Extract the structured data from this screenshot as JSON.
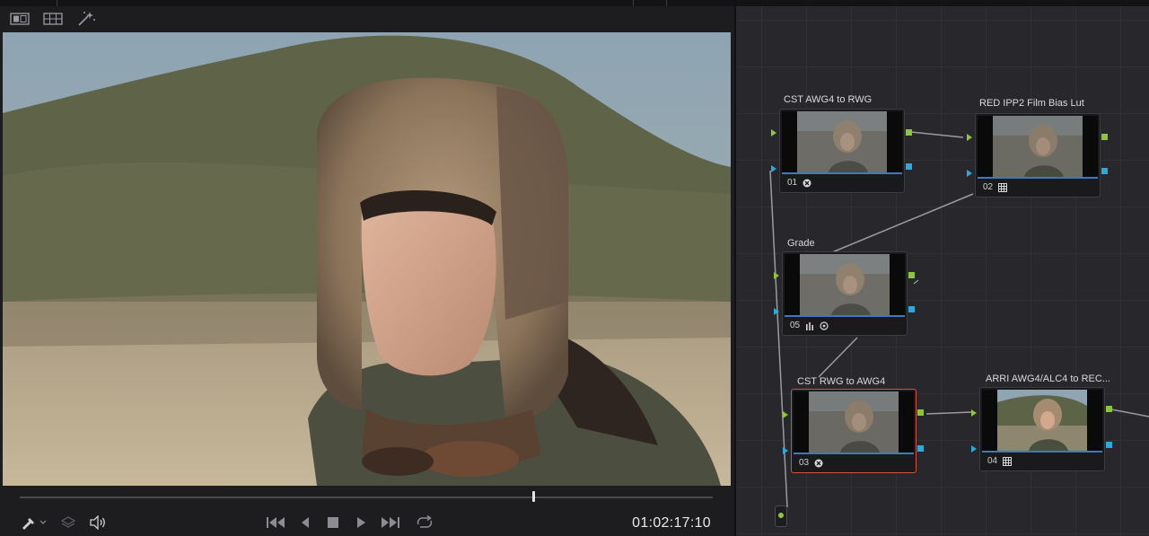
{
  "viewer": {
    "timecode": "01:02:17:10",
    "playhead_fraction": 0.74,
    "toolbar_icons": [
      "single-viewer-icon",
      "split-viewer-icon",
      "magic-wand-icon"
    ],
    "transport_icons": [
      "eyedropper-icon",
      "layers-icon",
      "speaker-icon",
      "skip-start-icon",
      "step-back-icon",
      "stop-icon",
      "play-icon",
      "skip-end-icon",
      "loop-icon"
    ]
  },
  "nodes": [
    {
      "label": "CST AWG4 to RWG",
      "number": "01",
      "tool": "color-space-transform-icon"
    },
    {
      "label": "RED IPP2 Film Bias Lut",
      "number": "02",
      "tool": "lut-icon"
    },
    {
      "label": "Grade",
      "number": "05",
      "tool": "curves-icon"
    },
    {
      "label": "CST RWG  to AWG4",
      "number": "03",
      "tool": "color-space-transform-icon",
      "selected": true
    },
    {
      "label": "ARRI AWG4/ALC4 to REC...",
      "number": "04",
      "tool": "lut-icon"
    }
  ],
  "colors": {
    "accent_green": "#8cc63f",
    "accent_blue": "#2fa8e0",
    "selected_border": "#d2533f",
    "node_bar": "#3f78c0"
  }
}
